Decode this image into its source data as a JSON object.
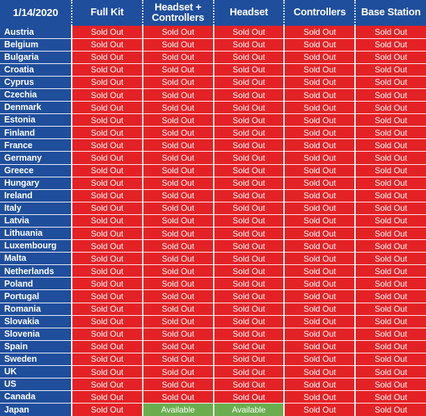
{
  "table": {
    "date_label": "1/14/2020",
    "columns": [
      "Full Kit",
      "Headset + Controllers",
      "Headset",
      "Controllers",
      "Base Station"
    ],
    "status_labels": {
      "sold_out": "Sold Out",
      "available": "Available"
    },
    "colors": {
      "header_blue": "#1f4e9c",
      "sold_out_red": "#e42226",
      "available_green": "#6aad4f",
      "divider_white": "#ffffff",
      "text_white": "#ffffff"
    },
    "rows": [
      {
        "country": "Austria",
        "statuses": [
          "Sold Out",
          "Sold Out",
          "Sold Out",
          "Sold Out",
          "Sold Out"
        ]
      },
      {
        "country": "Belgium",
        "statuses": [
          "Sold Out",
          "Sold Out",
          "Sold Out",
          "Sold Out",
          "Sold Out"
        ]
      },
      {
        "country": "Bulgaria",
        "statuses": [
          "Sold Out",
          "Sold Out",
          "Sold Out",
          "Sold Out",
          "Sold Out"
        ]
      },
      {
        "country": "Croatia",
        "statuses": [
          "Sold Out",
          "Sold Out",
          "Sold Out",
          "Sold Out",
          "Sold Out"
        ]
      },
      {
        "country": "Cyprus",
        "statuses": [
          "Sold Out",
          "Sold Out",
          "Sold Out",
          "Sold Out",
          "Sold Out"
        ]
      },
      {
        "country": "Czechia",
        "statuses": [
          "Sold Out",
          "Sold Out",
          "Sold Out",
          "Sold Out",
          "Sold Out"
        ]
      },
      {
        "country": "Denmark",
        "statuses": [
          "Sold Out",
          "Sold Out",
          "Sold Out",
          "Sold Out",
          "Sold Out"
        ]
      },
      {
        "country": "Estonia",
        "statuses": [
          "Sold Out",
          "Sold Out",
          "Sold Out",
          "Sold Out",
          "Sold Out"
        ]
      },
      {
        "country": "Finland",
        "statuses": [
          "Sold Out",
          "Sold Out",
          "Sold Out",
          "Sold Out",
          "Sold Out"
        ]
      },
      {
        "country": "France",
        "statuses": [
          "Sold Out",
          "Sold Out",
          "Sold Out",
          "Sold Out",
          "Sold Out"
        ]
      },
      {
        "country": "Germany",
        "statuses": [
          "Sold Out",
          "Sold Out",
          "Sold Out",
          "Sold Out",
          "Sold Out"
        ]
      },
      {
        "country": "Greece",
        "statuses": [
          "Sold Out",
          "Sold Out",
          "Sold Out",
          "Sold Out",
          "Sold Out"
        ]
      },
      {
        "country": "Hungary",
        "statuses": [
          "Sold Out",
          "Sold Out",
          "Sold Out",
          "Sold Out",
          "Sold Out"
        ]
      },
      {
        "country": "Ireland",
        "statuses": [
          "Sold Out",
          "Sold Out",
          "Sold Out",
          "Sold Out",
          "Sold Out"
        ]
      },
      {
        "country": "Italy",
        "statuses": [
          "Sold Out",
          "Sold Out",
          "Sold Out",
          "Sold Out",
          "Sold Out"
        ]
      },
      {
        "country": "Latvia",
        "statuses": [
          "Sold Out",
          "Sold Out",
          "Sold Out",
          "Sold Out",
          "Sold Out"
        ]
      },
      {
        "country": "Lithuania",
        "statuses": [
          "Sold Out",
          "Sold Out",
          "Sold Out",
          "Sold Out",
          "Sold Out"
        ]
      },
      {
        "country": "Luxembourg",
        "statuses": [
          "Sold Out",
          "Sold Out",
          "Sold Out",
          "Sold Out",
          "Sold Out"
        ]
      },
      {
        "country": "Malta",
        "statuses": [
          "Sold Out",
          "Sold Out",
          "Sold Out",
          "Sold Out",
          "Sold Out"
        ]
      },
      {
        "country": "Netherlands",
        "statuses": [
          "Sold Out",
          "Sold Out",
          "Sold Out",
          "Sold Out",
          "Sold Out"
        ]
      },
      {
        "country": "Poland",
        "statuses": [
          "Sold Out",
          "Sold Out",
          "Sold Out",
          "Sold Out",
          "Sold Out"
        ]
      },
      {
        "country": "Portugal",
        "statuses": [
          "Sold Out",
          "Sold Out",
          "Sold Out",
          "Sold Out",
          "Sold Out"
        ]
      },
      {
        "country": "Romania",
        "statuses": [
          "Sold Out",
          "Sold Out",
          "Sold Out",
          "Sold Out",
          "Sold Out"
        ]
      },
      {
        "country": "Slovakia",
        "statuses": [
          "Sold Out",
          "Sold Out",
          "Sold Out",
          "Sold Out",
          "Sold Out"
        ]
      },
      {
        "country": "Slovenia",
        "statuses": [
          "Sold Out",
          "Sold Out",
          "Sold Out",
          "Sold Out",
          "Sold Out"
        ]
      },
      {
        "country": "Spain",
        "statuses": [
          "Sold Out",
          "Sold Out",
          "Sold Out",
          "Sold Out",
          "Sold Out"
        ]
      },
      {
        "country": "Sweden",
        "statuses": [
          "Sold Out",
          "Sold Out",
          "Sold Out",
          "Sold Out",
          "Sold Out"
        ]
      },
      {
        "country": "UK",
        "statuses": [
          "Sold Out",
          "Sold Out",
          "Sold Out",
          "Sold Out",
          "Sold Out"
        ]
      },
      {
        "country": "US",
        "statuses": [
          "Sold Out",
          "Sold Out",
          "Sold Out",
          "Sold Out",
          "Sold Out"
        ]
      },
      {
        "country": "Canada",
        "statuses": [
          "Sold Out",
          "Sold Out",
          "Sold Out",
          "Sold Out",
          "Sold Out"
        ]
      },
      {
        "country": "Japan",
        "statuses": [
          "Sold Out",
          "Available",
          "Available",
          "Sold Out",
          "Sold Out"
        ]
      }
    ]
  }
}
